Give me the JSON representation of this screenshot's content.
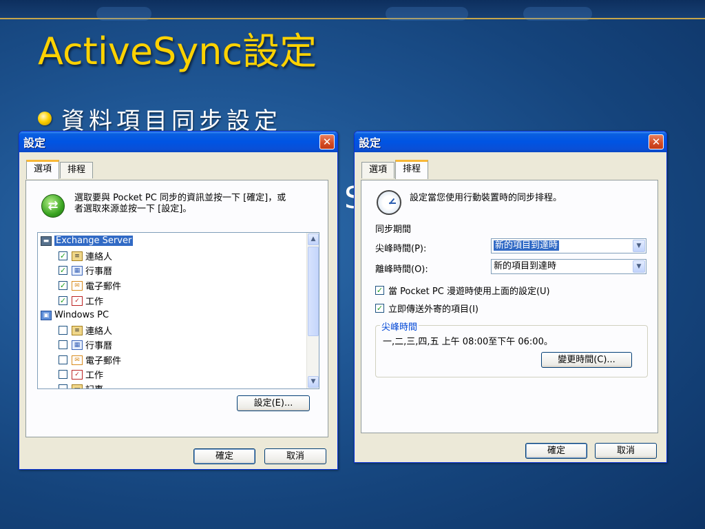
{
  "slide": {
    "title": "ActiveSync設定",
    "bullet": "資料項目同步設定",
    "hidden_char": "S"
  },
  "dialog_left": {
    "title": "設定",
    "tabs": [
      "選項",
      "排程"
    ],
    "active_tab": "選項",
    "instruction": "選取要與 Pocket PC 同步的資訊並按一下 [確定]，或者選取來源並按一下 [設定]。",
    "instruction_line1": "選取要與 Pocket PC 同步的資訊並按一下 [確定]，或",
    "instruction_line2": "者選取來源並按一下 [設定]。",
    "list": [
      {
        "label": "Exchange Server",
        "type": "source",
        "icon": "server-icon"
      },
      {
        "label": "連絡人",
        "checked": true,
        "icon": "contacts-icon"
      },
      {
        "label": "行事曆",
        "checked": true,
        "icon": "calendar-icon"
      },
      {
        "label": "電子郵件",
        "checked": true,
        "icon": "mail-icon"
      },
      {
        "label": "工作",
        "checked": true,
        "icon": "tasks-icon"
      },
      {
        "label": "Windows PC",
        "type": "source",
        "icon": "pc-icon"
      },
      {
        "label": "連絡人",
        "checked": false,
        "icon": "contacts-icon"
      },
      {
        "label": "行事曆",
        "checked": false,
        "icon": "calendar-icon"
      },
      {
        "label": "電子郵件",
        "checked": false,
        "icon": "mail-icon"
      },
      {
        "label": "工作",
        "checked": false,
        "icon": "tasks-icon"
      },
      {
        "label": "記事",
        "checked": false,
        "icon": "notes-icon"
      }
    ],
    "settings_button": "設定(E)...",
    "ok": "確定",
    "cancel": "取消"
  },
  "dialog_right": {
    "title": "設定",
    "tabs": [
      "選項",
      "排程"
    ],
    "active_tab": "排程",
    "description": "設定當您使用行動裝置時的同步排程。",
    "section_label": "同步期間",
    "peak_label": "尖峰時間(P):",
    "peak_value": "新的項目到達時",
    "offpeak_label": "離峰時間(O):",
    "offpeak_value": "新的項目到達時",
    "roaming_check": "當 Pocket PC 漫遊時使用上面的設定(U)",
    "send_check": "立即傳送外寄的項目(I)",
    "group_title": "尖峰時間",
    "group_text": "一,二,三,四,五 上午 08:00至下午 06:00。",
    "change_button": "變更時間(C)...",
    "ok": "確定",
    "cancel": "取消"
  },
  "colors": {
    "title_yellow": "#ffd200",
    "xp_blue": "#0054e3",
    "dialog_bg": "#ece9d8"
  }
}
